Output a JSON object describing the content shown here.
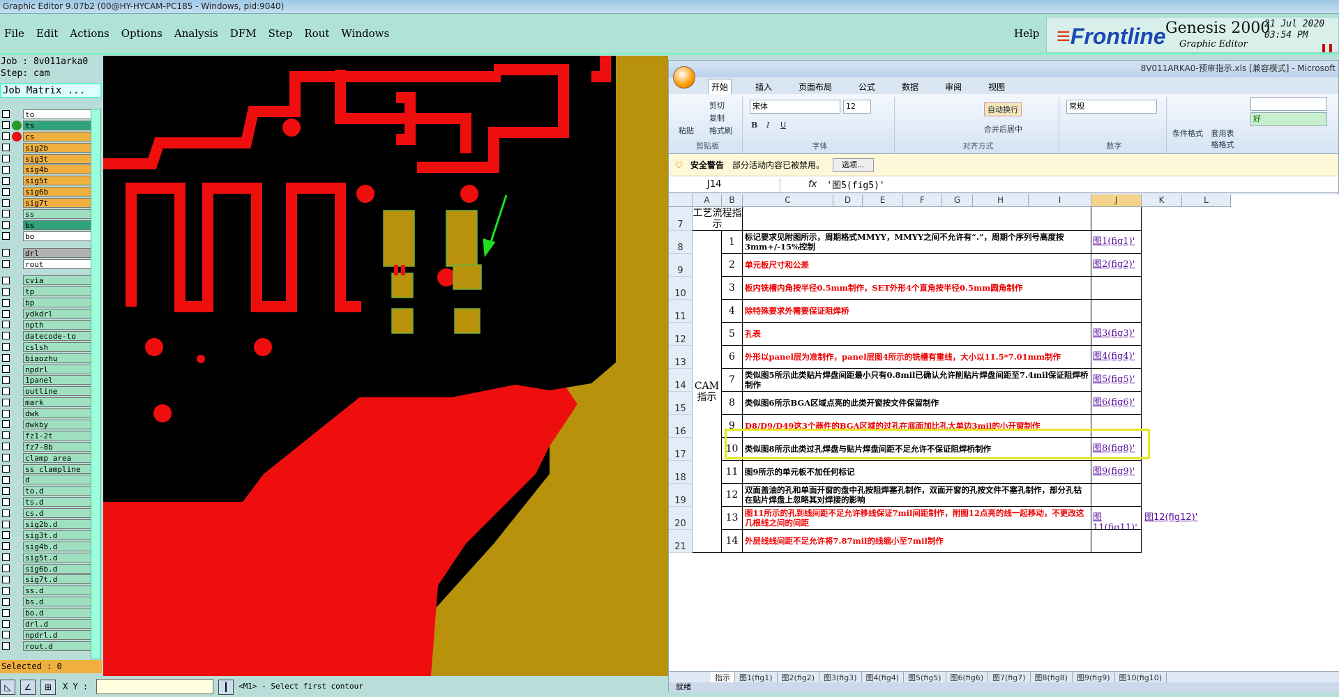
{
  "window_title": "Graphic Editor 9.07b2 (00@HY-HYCAM-PC185 - Windows, pid:9040)",
  "menu": [
    "File",
    "Edit",
    "Actions",
    "Options",
    "Analysis",
    "DFM",
    "Step",
    "Rout",
    "Windows"
  ],
  "help": "Help",
  "logo": {
    "brand": "Frontline",
    "product": "Genesis 2000",
    "subtitle": "Graphic Editor",
    "date": "21 Jul 2020",
    "time": "03:54 PM"
  },
  "job": "Job : 8v011arka0",
  "step": "Step: cam",
  "job_matrix": "Job Matrix ...",
  "layers": [
    {
      "name": "to",
      "color": "#ffffff",
      "dot": ""
    },
    {
      "name": "ts",
      "color": "#2fa37a",
      "dot": "#2a9a2a"
    },
    {
      "name": "cs",
      "color": "#f0b040",
      "dot": "#e81010"
    },
    {
      "name": "sig2b",
      "color": "#f0b040",
      "dot": ""
    },
    {
      "name": "sig3t",
      "color": "#f0b040",
      "dot": ""
    },
    {
      "name": "sig4b",
      "color": "#f0b040",
      "dot": ""
    },
    {
      "name": "sig5t",
      "color": "#f0b040",
      "dot": ""
    },
    {
      "name": "sig6b",
      "color": "#f0b040",
      "dot": ""
    },
    {
      "name": "sig7t",
      "color": "#f0b040",
      "dot": ""
    },
    {
      "name": "ss",
      "color": "#9fe0c0",
      "dot": ""
    },
    {
      "name": "bs",
      "color": "#2fa37a",
      "dot": ""
    },
    {
      "name": "bo",
      "color": "#ffffff",
      "dot": ""
    },
    {
      "name": "",
      "color": "",
      "dot": ""
    },
    {
      "name": "drl",
      "color": "#b0b0b0",
      "dot": ""
    },
    {
      "name": "rout",
      "color": "#ffffff",
      "dot": ""
    },
    {
      "name": "",
      "color": "",
      "dot": ""
    },
    {
      "name": "cvia",
      "color": "#9fe0c0",
      "dot": ""
    },
    {
      "name": "tp",
      "color": "#9fe0c0",
      "dot": ""
    },
    {
      "name": "bp",
      "color": "#9fe0c0",
      "dot": ""
    },
    {
      "name": "ydkdrl",
      "color": "#9fe0c0",
      "dot": ""
    },
    {
      "name": "npth",
      "color": "#9fe0c0",
      "dot": ""
    },
    {
      "name": "datecode-to",
      "color": "#9fe0c0",
      "dot": ""
    },
    {
      "name": "cslsh",
      "color": "#9fe0c0",
      "dot": ""
    },
    {
      "name": "biaozhu",
      "color": "#9fe0c0",
      "dot": ""
    },
    {
      "name": "npdrl",
      "color": "#9fe0c0",
      "dot": ""
    },
    {
      "name": "1panel",
      "color": "#9fe0c0",
      "dot": ""
    },
    {
      "name": "outline",
      "color": "#9fe0c0",
      "dot": ""
    },
    {
      "name": "mark",
      "color": "#9fe0c0",
      "dot": ""
    },
    {
      "name": "dwk",
      "color": "#9fe0c0",
      "dot": ""
    },
    {
      "name": "dwkby",
      "color": "#9fe0c0",
      "dot": ""
    },
    {
      "name": "fz1-2t",
      "color": "#9fe0c0",
      "dot": ""
    },
    {
      "name": "fz7-8b",
      "color": "#9fe0c0",
      "dot": ""
    },
    {
      "name": "clamp_area",
      "color": "#9fe0c0",
      "dot": ""
    },
    {
      "name": "ss_clampline",
      "color": "#9fe0c0",
      "dot": ""
    },
    {
      "name": "d",
      "color": "#9fe0c0",
      "dot": ""
    },
    {
      "name": "to.d",
      "color": "#9fe0c0",
      "dot": ""
    },
    {
      "name": "ts.d",
      "color": "#9fe0c0",
      "dot": ""
    },
    {
      "name": "cs.d",
      "color": "#9fe0c0",
      "dot": ""
    },
    {
      "name": "sig2b.d",
      "color": "#9fe0c0",
      "dot": ""
    },
    {
      "name": "sig3t.d",
      "color": "#9fe0c0",
      "dot": ""
    },
    {
      "name": "sig4b.d",
      "color": "#9fe0c0",
      "dot": ""
    },
    {
      "name": "sig5t.d",
      "color": "#9fe0c0",
      "dot": ""
    },
    {
      "name": "sig6b.d",
      "color": "#9fe0c0",
      "dot": ""
    },
    {
      "name": "sig7t.d",
      "color": "#9fe0c0",
      "dot": ""
    },
    {
      "name": "ss.d",
      "color": "#9fe0c0",
      "dot": ""
    },
    {
      "name": "bs.d",
      "color": "#9fe0c0",
      "dot": ""
    },
    {
      "name": "bo.d",
      "color": "#9fe0c0",
      "dot": ""
    },
    {
      "name": "drl.d",
      "color": "#9fe0c0",
      "dot": ""
    },
    {
      "name": "npdrl.d",
      "color": "#9fe0c0",
      "dot": ""
    },
    {
      "name": "rout.d",
      "color": "#9fe0c0",
      "dot": ""
    }
  ],
  "selected": "Selected : 0",
  "xy_label": "X Y :",
  "status_msg": "<M1> - Select first contour",
  "excel": {
    "title": "8V011ARKA0-预审指示.xls [兼容模式] - Microsoft",
    "tabs": [
      "开始",
      "插入",
      "页面布局",
      "公式",
      "数据",
      "审阅",
      "视图"
    ],
    "clipboard": {
      "paste": "粘贴",
      "cut": "剪切",
      "copy": "复制",
      "format": "格式刷",
      "label": "剪贴板"
    },
    "font": {
      "name": "宋体",
      "size": "12",
      "label": "字体"
    },
    "align": {
      "wrap": "自动换行",
      "merge": "合并后居中",
      "label": "对齐方式"
    },
    "number": {
      "format": "常规",
      "label": "数字"
    },
    "styles": {
      "cond": "条件格式",
      "table": "套用表格格式",
      "good": "好"
    },
    "security": {
      "label": "安全警告",
      "text": "部分活动内容已被禁用。",
      "button": "选项..."
    },
    "namebox": "J14",
    "formula": "'图5(fig5)'",
    "columns": [
      "A",
      "B",
      "C",
      "D",
      "E",
      "F",
      "G",
      "H",
      "I",
      "J",
      "K",
      "L"
    ],
    "col_c_header": "工艺流程指示",
    "col_a_merged": "CAM指示",
    "rows": [
      {
        "row": "8",
        "n": "1",
        "text": "标记要求见附图所示，周期格式MMYY，MMYY之间不允许有“.”，周期个序列号高度按3mm+/-15%控制",
        "red": false,
        "link": "图1(fig1)'"
      },
      {
        "row": "9",
        "n": "2",
        "text": "单元板尺寸和公差",
        "red": true,
        "link": "图2(fig2)'"
      },
      {
        "row": "10",
        "n": "3",
        "text": "板内铣槽内角按半径0.5mm制作，SET外形4个直角按半径0.5mm圆角制作",
        "red": true,
        "link": ""
      },
      {
        "row": "11",
        "n": "4",
        "text": "除特殊要求外需要保证阻焊桥",
        "red": true,
        "link": ""
      },
      {
        "row": "12",
        "n": "5",
        "text": "孔表",
        "red": true,
        "link": "图3(fig3)'"
      },
      {
        "row": "13",
        "n": "6",
        "text": "外形以panel层为准制作，panel层图4所示的铣槽有重线，大小以11.5*7.01mm制作",
        "red": true,
        "link": "图4(fig4)'"
      },
      {
        "row": "14",
        "n": "7",
        "text": "类似图5所示此类贴片焊盘间距最小只有0.8mil已确认允许削贴片焊盘间距至7.4mil保证阻焊桥制作",
        "red": false,
        "link": "图5(fig5)'"
      },
      {
        "row": "15",
        "n": "8",
        "text": "类似图6所示BGA区域点亮的此类开窗按文件保留制作",
        "red": false,
        "link": "图6(fig6)'"
      },
      {
        "row": "16",
        "n": "9",
        "text": "D8/D9/D49这3个器件的BGA区域的过孔在底面加比孔大单边3mil的小开窗制作",
        "red": true,
        "link": ""
      },
      {
        "row": "17",
        "n": "10",
        "text": "类似图8所示此类过孔焊盘与贴片焊盘间距不足允许不保证阻焊桥制作",
        "red": false,
        "link": "图8(fig8)'"
      },
      {
        "row": "18",
        "n": "11",
        "text": "图9所示的单元板不加任何标记",
        "red": false,
        "link": "图9(fig9)'"
      },
      {
        "row": "19",
        "n": "12",
        "text": "双面盖油的孔和单面开窗的盘中孔按阻焊塞孔制作，双面开窗的孔按文件不塞孔制作，部分孔钻在贴片焊盘上忽略其对焊接的影响",
        "red": false,
        "link": ""
      },
      {
        "row": "20",
        "n": "13",
        "text": "图11所示的孔到线间距不足允许移线保证7mil间距制作，附图12点亮的线一起移动，不更改这几根线之间的间距",
        "red": true,
        "link": "图11(fig11)'",
        "link2": "图12(fig12)'"
      },
      {
        "row": "21",
        "n": "14",
        "text": "外层线线间距不足允许将7.87mil的线缩小至7mil制作",
        "red": true,
        "link": ""
      }
    ],
    "row7": "7",
    "sheet_tabs": [
      "指示",
      "图1(fig1)",
      "图2(fig2)",
      "图3(fig3)",
      "图4(fig4)",
      "图5(fig5)",
      "图6(fig6)",
      "图7(fig7)",
      "图8(fig8)",
      "图9(fig9)",
      "图10(fig10)"
    ],
    "status": "就绪"
  }
}
